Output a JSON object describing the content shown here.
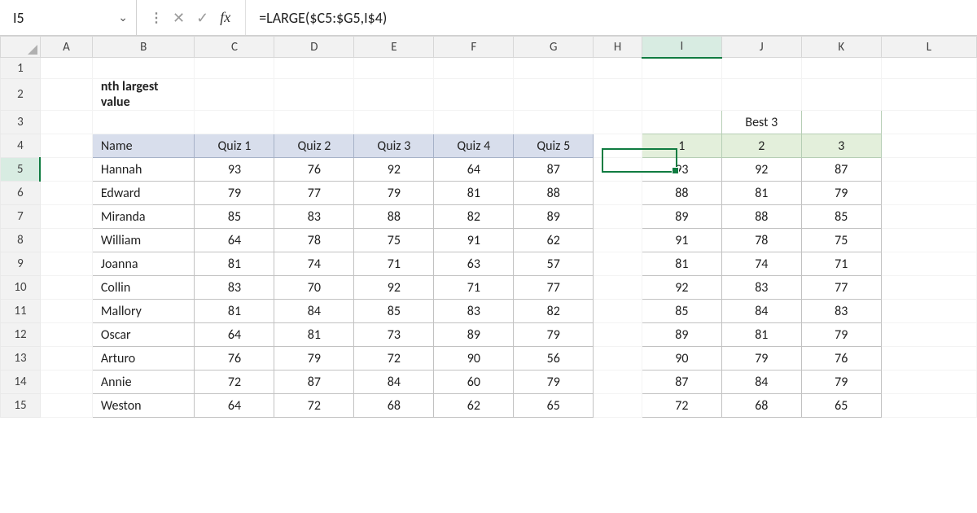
{
  "formula_bar": {
    "cell_ref": "I5",
    "fx_label": "fx",
    "formula": "=LARGE($C5:$G5,I$4)"
  },
  "columns": [
    "A",
    "B",
    "C",
    "D",
    "E",
    "F",
    "G",
    "H",
    "I",
    "J",
    "K",
    "L"
  ],
  "row_numbers": [
    "1",
    "2",
    "3",
    "4",
    "5",
    "6",
    "7",
    "8",
    "9",
    "10",
    "11",
    "12",
    "13",
    "14",
    "15"
  ],
  "active_col_index": 8,
  "active_row_index": 4,
  "title": "nth largest value",
  "table": {
    "headers": [
      "Name",
      "Quiz 1",
      "Quiz 2",
      "Quiz 3",
      "Quiz 4",
      "Quiz 5"
    ],
    "rows": [
      {
        "name": "Hannah",
        "q": [
          "93",
          "76",
          "92",
          "64",
          "87"
        ]
      },
      {
        "name": "Edward",
        "q": [
          "79",
          "77",
          "79",
          "81",
          "88"
        ]
      },
      {
        "name": "Miranda",
        "q": [
          "85",
          "83",
          "88",
          "82",
          "89"
        ]
      },
      {
        "name": "William",
        "q": [
          "64",
          "78",
          "75",
          "91",
          "62"
        ]
      },
      {
        "name": "Joanna",
        "q": [
          "81",
          "74",
          "71",
          "63",
          "57"
        ]
      },
      {
        "name": "Collin",
        "q": [
          "83",
          "70",
          "92",
          "71",
          "77"
        ]
      },
      {
        "name": "Mallory",
        "q": [
          "81",
          "84",
          "85",
          "83",
          "82"
        ]
      },
      {
        "name": "Oscar",
        "q": [
          "64",
          "81",
          "73",
          "89",
          "79"
        ]
      },
      {
        "name": "Arturo",
        "q": [
          "76",
          "79",
          "72",
          "90",
          "56"
        ]
      },
      {
        "name": "Annie",
        "q": [
          "72",
          "87",
          "84",
          "60",
          "79"
        ]
      },
      {
        "name": "Weston",
        "q": [
          "64",
          "72",
          "68",
          "62",
          "65"
        ]
      }
    ]
  },
  "best": {
    "title": "Best 3",
    "subheaders": [
      "1",
      "2",
      "3"
    ],
    "rows": [
      [
        "93",
        "92",
        "87"
      ],
      [
        "88",
        "81",
        "79"
      ],
      [
        "89",
        "88",
        "85"
      ],
      [
        "91",
        "78",
        "75"
      ],
      [
        "81",
        "74",
        "71"
      ],
      [
        "92",
        "83",
        "77"
      ],
      [
        "85",
        "84",
        "83"
      ],
      [
        "89",
        "81",
        "79"
      ],
      [
        "90",
        "79",
        "76"
      ],
      [
        "87",
        "84",
        "79"
      ],
      [
        "72",
        "68",
        "65"
      ]
    ]
  },
  "chart_data": {
    "type": "table",
    "title": "nth largest value",
    "left_table": {
      "columns": [
        "Name",
        "Quiz 1",
        "Quiz 2",
        "Quiz 3",
        "Quiz 4",
        "Quiz 5"
      ],
      "data": [
        [
          "Hannah",
          93,
          76,
          92,
          64,
          87
        ],
        [
          "Edward",
          79,
          77,
          79,
          81,
          88
        ],
        [
          "Miranda",
          85,
          83,
          88,
          82,
          89
        ],
        [
          "William",
          64,
          78,
          75,
          91,
          62
        ],
        [
          "Joanna",
          81,
          74,
          71,
          63,
          57
        ],
        [
          "Collin",
          83,
          70,
          92,
          71,
          77
        ],
        [
          "Mallory",
          81,
          84,
          85,
          83,
          82
        ],
        [
          "Oscar",
          64,
          81,
          73,
          89,
          79
        ],
        [
          "Arturo",
          76,
          79,
          72,
          90,
          56
        ],
        [
          "Annie",
          72,
          87,
          84,
          60,
          79
        ],
        [
          "Weston",
          64,
          72,
          68,
          62,
          65
        ]
      ]
    },
    "right_table": {
      "title": "Best 3",
      "columns": [
        1,
        2,
        3
      ],
      "data": [
        [
          93,
          92,
          87
        ],
        [
          88,
          81,
          79
        ],
        [
          89,
          88,
          85
        ],
        [
          91,
          78,
          75
        ],
        [
          81,
          74,
          71
        ],
        [
          92,
          83,
          77
        ],
        [
          85,
          84,
          83
        ],
        [
          89,
          81,
          79
        ],
        [
          90,
          79,
          76
        ],
        [
          87,
          84,
          79
        ],
        [
          72,
          68,
          65
        ]
      ]
    },
    "formula": "=LARGE($C5:$G5,I$4)",
    "active_cell": "I5"
  }
}
